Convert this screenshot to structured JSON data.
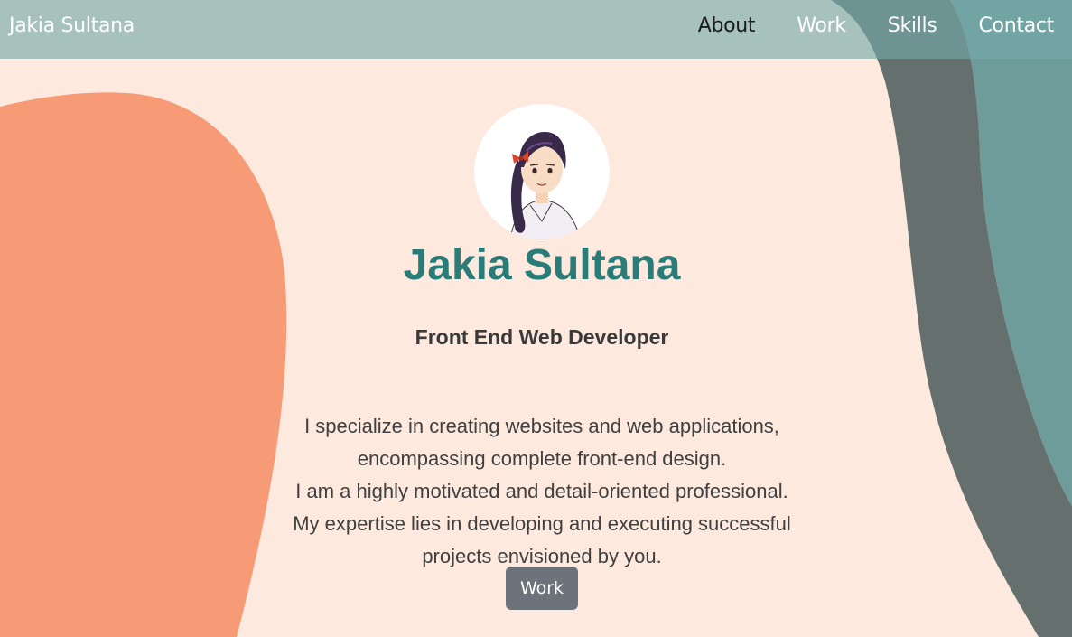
{
  "navbar": {
    "brand": "Jakia Sultana",
    "links": [
      {
        "label": "About",
        "active": true
      },
      {
        "label": "Work",
        "active": false
      },
      {
        "label": "Skills",
        "active": false
      },
      {
        "label": "Contact",
        "active": false
      }
    ]
  },
  "hero": {
    "name": "Jakia Sultana",
    "role": "Front End Web Developer",
    "description": [
      "I specialize in creating websites and web applications,",
      "encompassing complete front-end design.",
      "I am a highly motivated and detail-oriented professional.",
      "My expertise lies in developing and executing successful",
      "projects envisioned by you."
    ],
    "button_label": "Work"
  },
  "colors": {
    "page_background": "#fde9de",
    "navbar": "#73aaa8",
    "left_blob": "#f79b77",
    "right_blob_dark": "#65706e",
    "right_blob_teal": "#6e9c9b",
    "name_color": "#2a7c78",
    "button": "#6c737a"
  },
  "icons": {
    "avatar": "cartoon-girl-avatar"
  }
}
